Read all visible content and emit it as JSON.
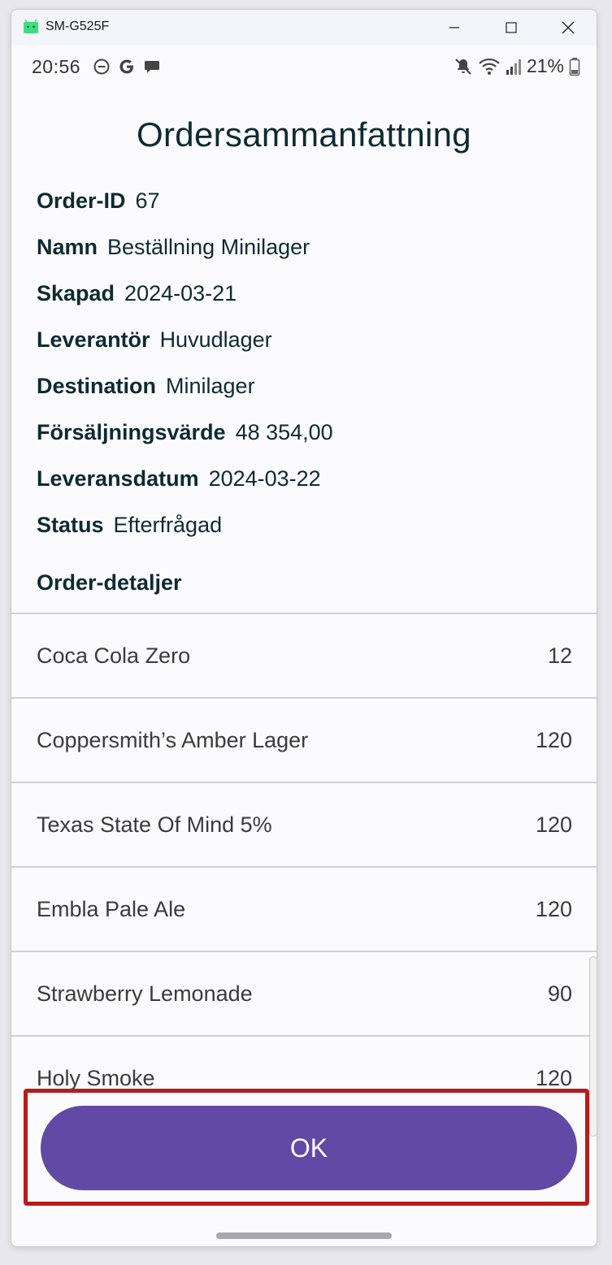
{
  "window": {
    "title": "SM-G525F",
    "controls": [
      "minimize",
      "maximize",
      "close"
    ]
  },
  "status_bar": {
    "time": "20:56",
    "battery": "21%",
    "left_icons": [
      "do-not-disturb-icon",
      "google-icon",
      "chat-icon"
    ],
    "right_icons": [
      "mute-icon",
      "wifi-icon",
      "signal-icon",
      "battery-icon"
    ]
  },
  "page": {
    "title": "Ordersammanfattning",
    "fields": [
      {
        "label": "Order-ID",
        "value": "67"
      },
      {
        "label": "Namn",
        "value": "Beställning Minilager"
      },
      {
        "label": "Skapad",
        "value": "2024-03-21"
      },
      {
        "label": "Leverantör",
        "value": "Huvudlager"
      },
      {
        "label": "Destination",
        "value": "Minilager"
      },
      {
        "label": "Försäljningsvärde",
        "value": "48 354,00"
      },
      {
        "label": "Leveransdatum",
        "value": "2024-03-22"
      },
      {
        "label": "Status",
        "value": "Efterfrågad"
      }
    ],
    "details_title": "Order-detaljer",
    "items": [
      {
        "name": "Coca Cola Zero",
        "qty": "12"
      },
      {
        "name": "Coppersmith’s Amber Lager",
        "qty": "120"
      },
      {
        "name": "Texas State Of Mind 5%",
        "qty": "120"
      },
      {
        "name": "Embla Pale Ale",
        "qty": "120"
      },
      {
        "name": "Strawberry Lemonade",
        "qty": "90"
      },
      {
        "name": "Holy Smoke",
        "qty": "120"
      }
    ],
    "ok_label": "OK"
  },
  "colors": {
    "accent": "#6249a6",
    "text_dark": "#0e2a33",
    "highlight": "#b71c1c"
  }
}
